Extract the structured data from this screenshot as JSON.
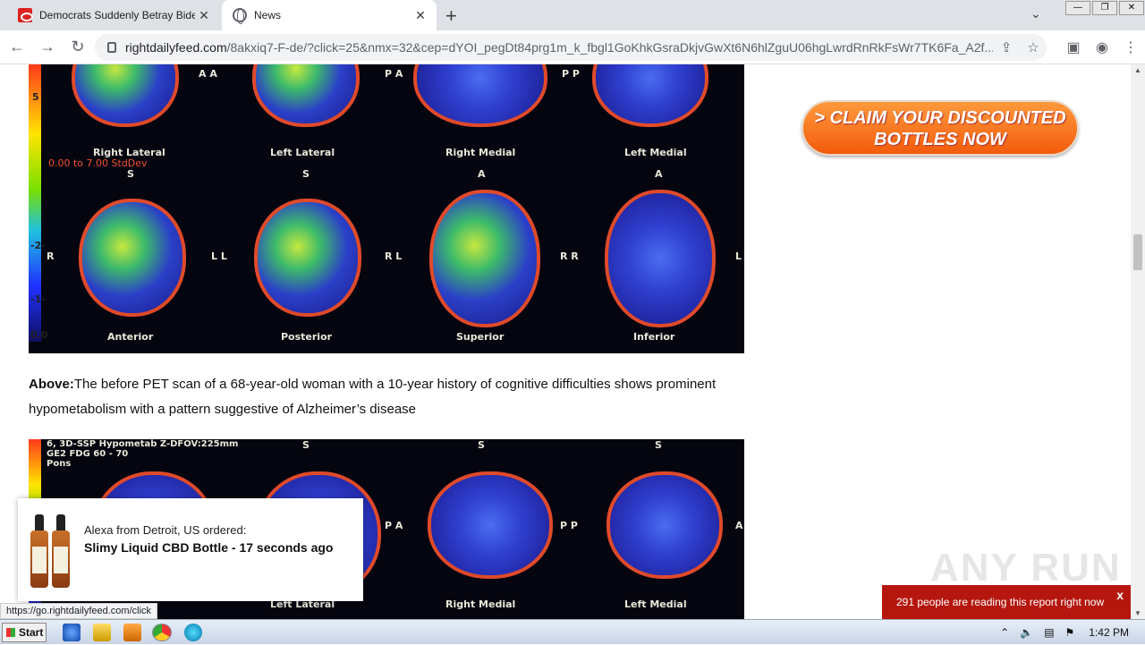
{
  "browser": {
    "tabs": [
      {
        "title": "Democrats Suddenly Betray Biden ov",
        "active": false
      },
      {
        "title": "News",
        "active": true
      }
    ],
    "url_domain": "rightdailyfeed.com",
    "url_path": "/8akxiq7-F-de/?click=25&nmx=32&cep=dYOI_pegDt84prg1m_k_fbgl1GoKhkGsraDkjvGwXt6N6hlZguU06hgLwrdRnRkFsWr7TK6Fa_A2f..."
  },
  "scan_top": {
    "row1_labels": [
      "Right Lateral",
      "Left Lateral",
      "Right Medial",
      "Left Medial"
    ],
    "row2_labels": [
      "Anterior",
      "Posterior",
      "Superior",
      "Inferior"
    ],
    "scale_text": "0.00 to 7.00 StdDev",
    "side_letters": [
      "R",
      "L L",
      "R L",
      "R R",
      "L"
    ],
    "top_letters": [
      "A A",
      "P A",
      "P P",
      "S",
      "S",
      "A",
      "A"
    ],
    "axis_ticks": [
      "5",
      "-2-",
      "-1-",
      "0.0"
    ]
  },
  "caption": {
    "bold": "Above:",
    "text": "The before PET scan of a 68-year-old woman with a 10-year history of cognitive difficulties shows prominent hypometabolism with a pattern suggestive of Alzheimer’s disease"
  },
  "scan_bottom": {
    "header_lines": [
      "6, 3D-SSP Hypometab Z-DFOV:225mm",
      "GE2 FDG 60 - 70",
      "Pons"
    ],
    "labels": [
      "Left Lateral",
      "Right Medial",
      "Left Medial"
    ],
    "side_letters": [
      "P A",
      "P P",
      "A"
    ],
    "top_letters": [
      "S",
      "S",
      "S"
    ]
  },
  "cta": {
    "label": "> CLAIM YOUR DISCOUNTED BOTTLES NOW"
  },
  "popup": {
    "who": "Alexa from Detroit, US ordered:",
    "what": "Slimy Liquid CBD Bottle - 17 seconds ago"
  },
  "status_url": "https://go.rightdailyfeed.com/click",
  "readers_banner": {
    "text": "291 people are reading this report right now",
    "close": "x"
  },
  "watermark": "ANY RUN",
  "taskbar": {
    "start_label": "Start",
    "clock": "1:42 PM"
  }
}
